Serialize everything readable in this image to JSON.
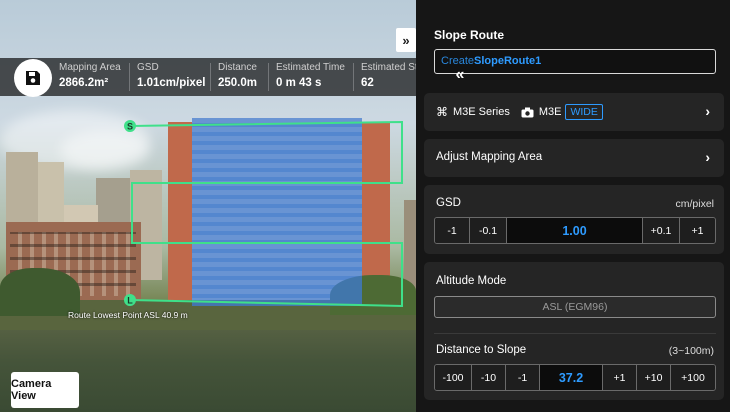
{
  "stats": {
    "mapping_area_label": "Mapping Area",
    "mapping_area_value": "2866.2m²",
    "gsd_label": "GSD",
    "gsd_value": "1.01cm/pixel",
    "distance_label": "Distance",
    "distance_value": "250.0m",
    "time_label": "Estimated Time",
    "time_value": "0 m 43 s",
    "storage_label": "Estimated Storage",
    "storage_value": "62"
  },
  "overlay": {
    "lowest_point": "Route Lowest Point ASL 40.9 m",
    "start_marker": "S",
    "land_marker": "L",
    "camera_view": "Camera View",
    "collapse_glyph": "»",
    "expand_glyph": "«"
  },
  "panel": {
    "title": "Slope Route",
    "route_name_prefix": "Create",
    "route_name": "SlopeRoute1",
    "drone_series": "M3E Series",
    "camera": "M3E",
    "lens": "WIDE",
    "adjust_area": "Adjust Mapping Area",
    "gsd": {
      "label": "GSD",
      "unit": "cm/pixel",
      "buttons": [
        "-1",
        "-0.1",
        "+0.1",
        "+1"
      ],
      "value": "1.00"
    },
    "altitude": {
      "label": "Altitude Mode",
      "value": "ASL (EGM96)"
    },
    "distance": {
      "label": "Distance to Slope",
      "range": "(3~100m)",
      "minus_buttons": [
        "-100",
        "-10",
        "-1"
      ],
      "value": "37.2",
      "plus_buttons": [
        "+1",
        "+10",
        "+100"
      ]
    }
  },
  "colors": {
    "accent": "#2e9bff",
    "route_line": "#3fe08a",
    "mapping_area_fill": "#3d7bd9"
  }
}
